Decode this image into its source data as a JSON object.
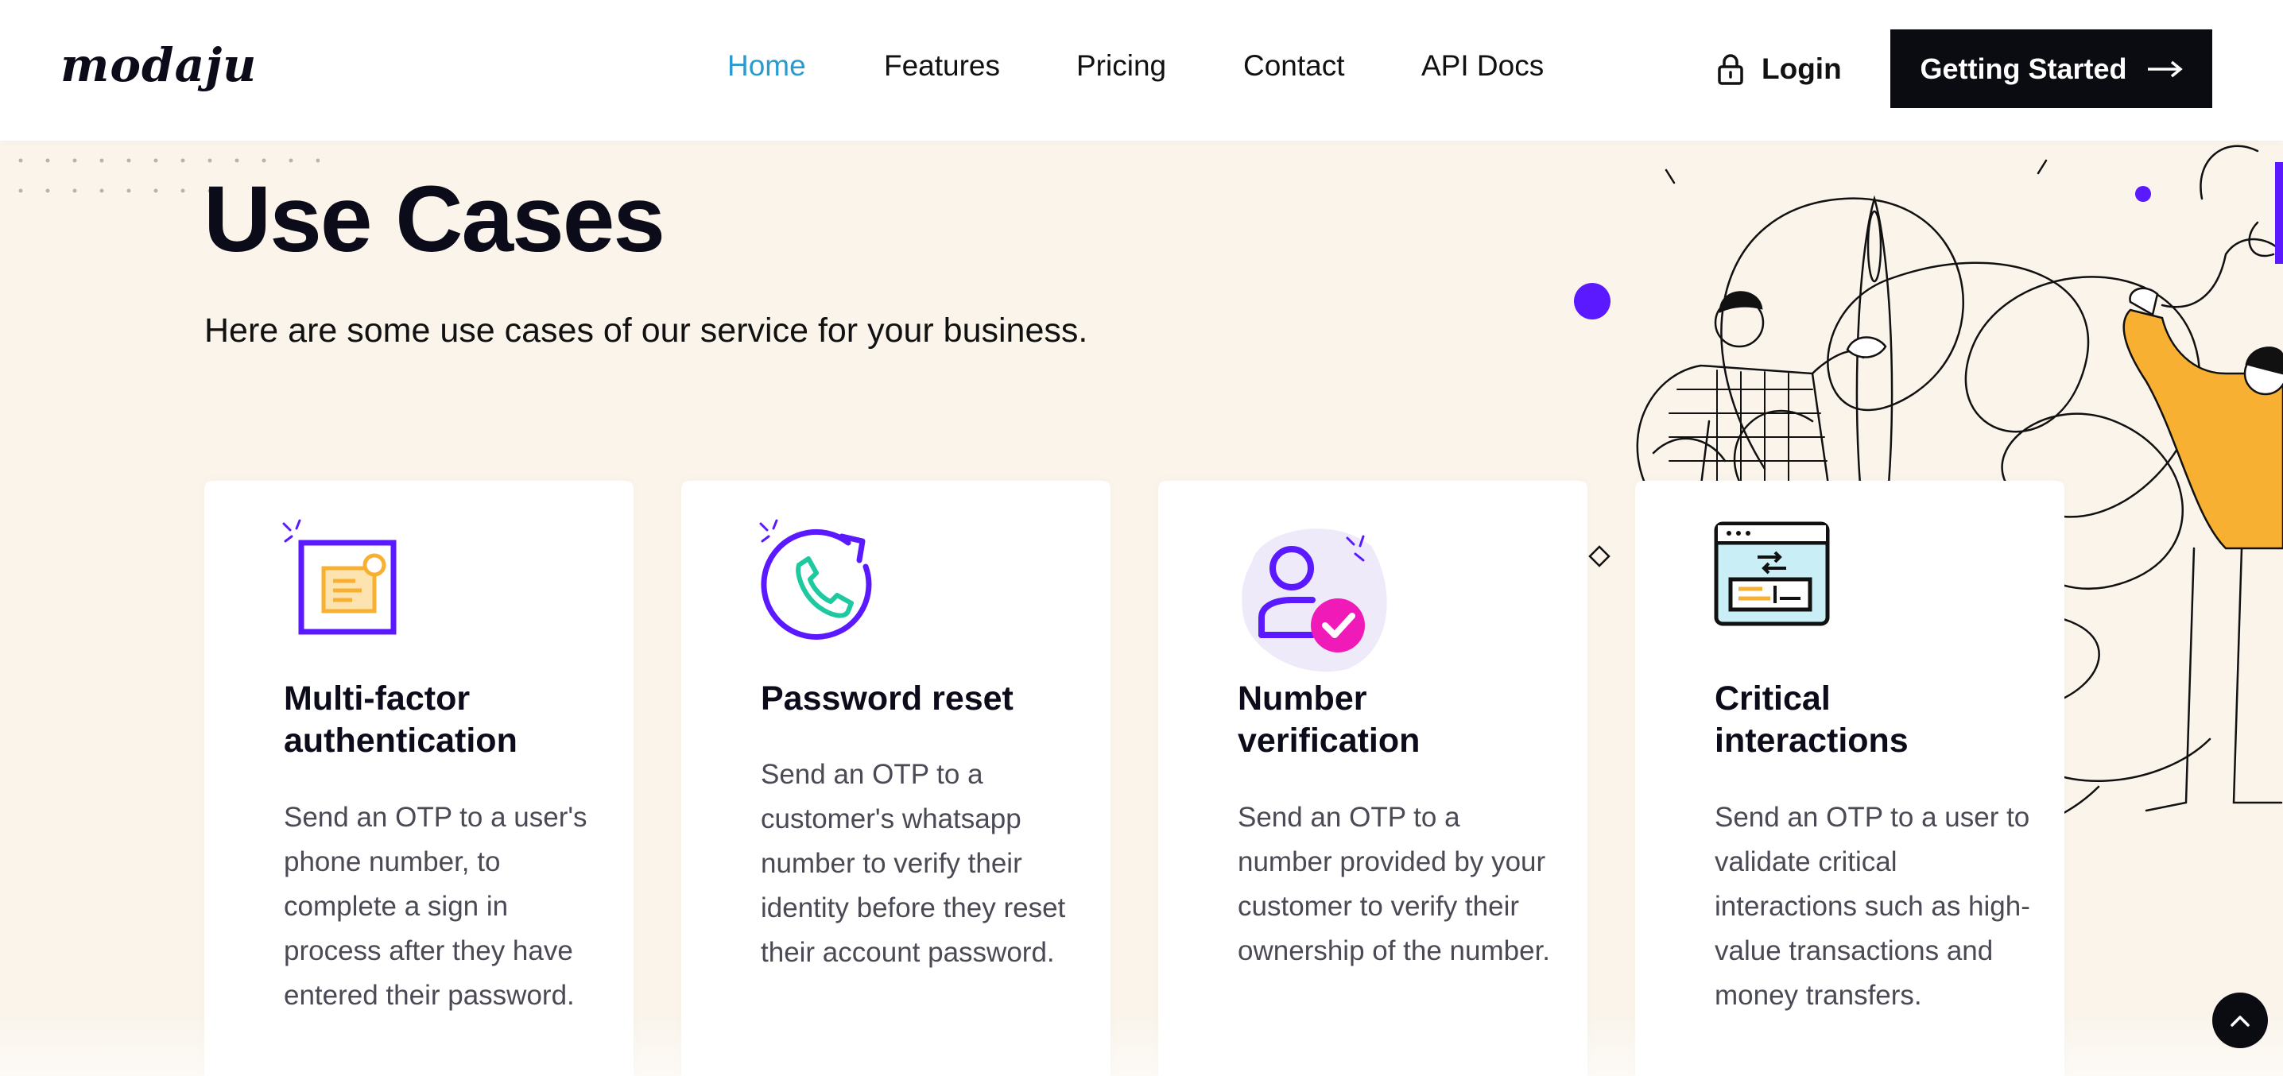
{
  "header": {
    "logo": "modaju",
    "nav": [
      {
        "label": "Home",
        "active": true
      },
      {
        "label": "Features",
        "active": false
      },
      {
        "label": "Pricing",
        "active": false
      },
      {
        "label": "Contact",
        "active": false
      },
      {
        "label": "API Docs",
        "active": false
      }
    ],
    "login_label": "Login",
    "cta_label": "Getting Started"
  },
  "hero": {
    "title": "Use Cases",
    "subtitle": "Here are some use cases of our service for your business."
  },
  "cards": [
    {
      "icon": "mfa-window-icon",
      "title": "Multi-factor authentication",
      "description": "Send an OTP to a user's phone number, to complete a sign in process after they have entered their password."
    },
    {
      "icon": "phone-refresh-icon",
      "title": "Password reset",
      "description": "Send an OTP to a customer's whatsapp number to verify their identity before they reset their account password."
    },
    {
      "icon": "user-verified-icon",
      "title": "Number verification",
      "description": "Send an OTP to a number provided by your customer to verify their ownership of the number."
    },
    {
      "icon": "browser-transfer-icon",
      "title": "Critical interactions",
      "description": "Send an OTP to a user to validate critical interactions such as high-value transactions and money transfers."
    }
  ],
  "colors": {
    "accent": "#5a19ff",
    "nav_active": "#2a9bd0",
    "page_bg": "#faf4eb",
    "dark": "#0b0b12",
    "orange": "#f7b032",
    "teal": "#1fc9a0",
    "magenta": "#f01ab8",
    "light_blue": "#c9eef6"
  }
}
